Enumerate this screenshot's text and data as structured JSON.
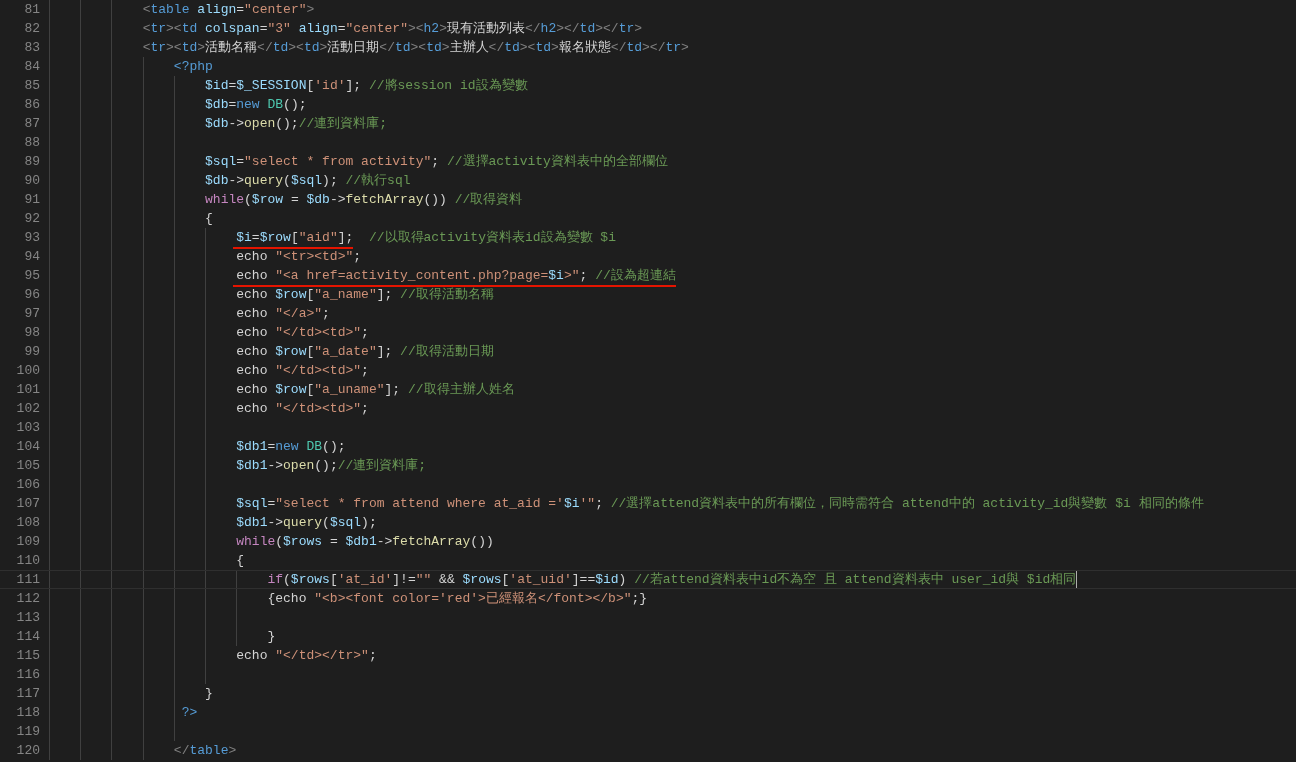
{
  "editor": {
    "lines": [
      {
        "n": "81",
        "current": false,
        "tokens": [
          {
            "text": "            <",
            "kind": "tb"
          },
          {
            "text": "table ",
            "kind": "tg"
          },
          {
            "text": "align",
            "kind": "at"
          },
          {
            "text": "=",
            "kind": "p"
          },
          {
            "text": "\"center\"",
            "kind": "s"
          },
          {
            "text": ">",
            "kind": "tb"
          }
        ]
      },
      {
        "n": "82",
        "current": false,
        "tokens": [
          {
            "text": "            <",
            "kind": "tb"
          },
          {
            "text": "tr",
            "kind": "tg"
          },
          {
            "text": "><",
            "kind": "tb"
          },
          {
            "text": "td ",
            "kind": "tg"
          },
          {
            "text": "colspan",
            "kind": "at"
          },
          {
            "text": "=",
            "kind": "p"
          },
          {
            "text": "\"3\" ",
            "kind": "s"
          },
          {
            "text": "align",
            "kind": "at"
          },
          {
            "text": "=",
            "kind": "p"
          },
          {
            "text": "\"center\"",
            "kind": "s"
          },
          {
            "text": "><",
            "kind": "tb"
          },
          {
            "text": "h2",
            "kind": "tg"
          },
          {
            "text": ">",
            "kind": "tb"
          },
          {
            "text": "現有活動列表",
            "kind": "p"
          },
          {
            "text": "</",
            "kind": "tb"
          },
          {
            "text": "h2",
            "kind": "tg"
          },
          {
            "text": "></",
            "kind": "tb"
          },
          {
            "text": "td",
            "kind": "tg"
          },
          {
            "text": "></",
            "kind": "tb"
          },
          {
            "text": "tr",
            "kind": "tg"
          },
          {
            "text": ">",
            "kind": "tb"
          }
        ]
      },
      {
        "n": "83",
        "current": false,
        "tokens": [
          {
            "text": "            <",
            "kind": "tb"
          },
          {
            "text": "tr",
            "kind": "tg"
          },
          {
            "text": "><",
            "kind": "tb"
          },
          {
            "text": "td",
            "kind": "tg"
          },
          {
            "text": ">",
            "kind": "tb"
          },
          {
            "text": "活動名稱",
            "kind": "p"
          },
          {
            "text": "</",
            "kind": "tb"
          },
          {
            "text": "td",
            "kind": "tg"
          },
          {
            "text": "><",
            "kind": "tb"
          },
          {
            "text": "td",
            "kind": "tg"
          },
          {
            "text": ">",
            "kind": "tb"
          },
          {
            "text": "活動日期",
            "kind": "p"
          },
          {
            "text": "</",
            "kind": "tb"
          },
          {
            "text": "td",
            "kind": "tg"
          },
          {
            "text": "><",
            "kind": "tb"
          },
          {
            "text": "td",
            "kind": "tg"
          },
          {
            "text": ">",
            "kind": "tb"
          },
          {
            "text": "主辦人",
            "kind": "p"
          },
          {
            "text": "</",
            "kind": "tb"
          },
          {
            "text": "td",
            "kind": "tg"
          },
          {
            "text": "><",
            "kind": "tb"
          },
          {
            "text": "td",
            "kind": "tg"
          },
          {
            "text": ">",
            "kind": "tb"
          },
          {
            "text": "報名狀態",
            "kind": "p"
          },
          {
            "text": "</",
            "kind": "tb"
          },
          {
            "text": "td",
            "kind": "tg"
          },
          {
            "text": "></",
            "kind": "tb"
          },
          {
            "text": "tr",
            "kind": "tg"
          },
          {
            "text": ">",
            "kind": "tb"
          }
        ]
      },
      {
        "n": "84",
        "current": false,
        "tokens": [
          {
            "text": "                <?php",
            "kind": "ph"
          }
        ]
      },
      {
        "n": "85",
        "current": false,
        "tokens": [
          {
            "text": "                    $id",
            "kind": "v"
          },
          {
            "text": "=",
            "kind": "p"
          },
          {
            "text": "$_SESSION",
            "kind": "v"
          },
          {
            "text": "[",
            "kind": "p"
          },
          {
            "text": "'id'",
            "kind": "s"
          },
          {
            "text": "]; ",
            "kind": "p"
          },
          {
            "text": "//將session id設為變數",
            "kind": "c"
          }
        ]
      },
      {
        "n": "86",
        "current": false,
        "tokens": [
          {
            "text": "                    $db",
            "kind": "v"
          },
          {
            "text": "=",
            "kind": "p"
          },
          {
            "text": "new ",
            "kind": "st"
          },
          {
            "text": "DB",
            "kind": "cl"
          },
          {
            "text": "();",
            "kind": "p"
          }
        ]
      },
      {
        "n": "87",
        "current": false,
        "tokens": [
          {
            "text": "                    $db",
            "kind": "v"
          },
          {
            "text": "->",
            "kind": "p"
          },
          {
            "text": "open",
            "kind": "f"
          },
          {
            "text": "();",
            "kind": "p"
          },
          {
            "text": "//連到資料庫;",
            "kind": "c"
          }
        ]
      },
      {
        "n": "88",
        "current": false
      },
      {
        "n": "89",
        "current": false,
        "tokens": [
          {
            "text": "                    $sql",
            "kind": "v"
          },
          {
            "text": "=",
            "kind": "p"
          },
          {
            "text": "\"select * from activity\"",
            "kind": "s"
          },
          {
            "text": "; ",
            "kind": "p"
          },
          {
            "text": "//選擇activity資料表中的全部欄位",
            "kind": "c"
          }
        ]
      },
      {
        "n": "90",
        "current": false,
        "tokens": [
          {
            "text": "                    $db",
            "kind": "v"
          },
          {
            "text": "->",
            "kind": "p"
          },
          {
            "text": "query",
            "kind": "f"
          },
          {
            "text": "(",
            "kind": "p"
          },
          {
            "text": "$sql",
            "kind": "v"
          },
          {
            "text": "); ",
            "kind": "p"
          },
          {
            "text": "//執行sql",
            "kind": "c"
          }
        ]
      },
      {
        "n": "91",
        "current": false,
        "tokens": [
          {
            "text": "                    while",
            "kind": "kw"
          },
          {
            "text": "(",
            "kind": "p"
          },
          {
            "text": "$row",
            "kind": "v"
          },
          {
            "text": " = ",
            "kind": "p"
          },
          {
            "text": "$db",
            "kind": "v"
          },
          {
            "text": "->",
            "kind": "p"
          },
          {
            "text": "fetchArray",
            "kind": "f"
          },
          {
            "text": "()) ",
            "kind": "p"
          },
          {
            "text": "//取得資料",
            "kind": "c"
          }
        ]
      },
      {
        "n": "92",
        "current": false,
        "tokens": [
          {
            "text": "                    {",
            "kind": "p"
          }
        ]
      },
      {
        "n": "93",
        "current": false,
        "tokens": [
          {
            "text": "                        $i",
            "kind": "v",
            "underlined": true
          },
          {
            "text": "=",
            "kind": "p",
            "underlined": true
          },
          {
            "text": "$row",
            "kind": "v",
            "underlined": true
          },
          {
            "text": "[",
            "kind": "p",
            "underlined": true
          },
          {
            "text": "\"aid\"",
            "kind": "s",
            "underlined": true
          },
          {
            "text": "];",
            "kind": "p",
            "underlined": true
          },
          {
            "text": "  //以取得activity資料表id設為變數 $i",
            "kind": "c"
          }
        ]
      },
      {
        "n": "94",
        "current": false,
        "tokens": [
          {
            "text": "                        echo ",
            "kind": "p"
          },
          {
            "text": "\"<tr><td>\"",
            "kind": "s"
          },
          {
            "text": ";",
            "kind": "p"
          }
        ]
      },
      {
        "n": "95",
        "current": false,
        "tokens": [
          {
            "text": "                        echo ",
            "kind": "p",
            "underlined": true
          },
          {
            "text": "\"<a href=activity_content.php?page=",
            "kind": "s",
            "underlined": true
          },
          {
            "text": "$i",
            "kind": "v",
            "underlined": true
          },
          {
            "text": ">\"",
            "kind": "s",
            "underlined": true
          },
          {
            "text": "; ",
            "kind": "p",
            "underlined": true
          },
          {
            "text": "//設為超連結",
            "kind": "c",
            "underlined": true
          }
        ]
      },
      {
        "n": "96",
        "current": false,
        "tokens": [
          {
            "text": "                        echo ",
            "kind": "p"
          },
          {
            "text": "$row",
            "kind": "v"
          },
          {
            "text": "[",
            "kind": "p"
          },
          {
            "text": "\"a_name\"",
            "kind": "s"
          },
          {
            "text": "]; ",
            "kind": "p"
          },
          {
            "text": "//取得活動名稱",
            "kind": "c"
          }
        ]
      },
      {
        "n": "97",
        "current": false,
        "tokens": [
          {
            "text": "                        echo ",
            "kind": "p"
          },
          {
            "text": "\"</a>\"",
            "kind": "s"
          },
          {
            "text": ";",
            "kind": "p"
          }
        ]
      },
      {
        "n": "98",
        "current": false,
        "tokens": [
          {
            "text": "                        echo ",
            "kind": "p"
          },
          {
            "text": "\"</td><td>\"",
            "kind": "s"
          },
          {
            "text": ";",
            "kind": "p"
          }
        ]
      },
      {
        "n": "99",
        "current": false,
        "tokens": [
          {
            "text": "                        echo ",
            "kind": "p"
          },
          {
            "text": "$row",
            "kind": "v"
          },
          {
            "text": "[",
            "kind": "p"
          },
          {
            "text": "\"a_date\"",
            "kind": "s"
          },
          {
            "text": "]; ",
            "kind": "p"
          },
          {
            "text": "//取得活動日期",
            "kind": "c"
          }
        ]
      },
      {
        "n": "100",
        "current": false,
        "tokens": [
          {
            "text": "                        echo ",
            "kind": "p"
          },
          {
            "text": "\"</td><td>\"",
            "kind": "s"
          },
          {
            "text": ";",
            "kind": "p"
          }
        ]
      },
      {
        "n": "101",
        "current": false,
        "tokens": [
          {
            "text": "                        echo ",
            "kind": "p"
          },
          {
            "text": "$row",
            "kind": "v"
          },
          {
            "text": "[",
            "kind": "p"
          },
          {
            "text": "\"a_uname\"",
            "kind": "s"
          },
          {
            "text": "]; ",
            "kind": "p"
          },
          {
            "text": "//取得主辦人姓名",
            "kind": "c"
          }
        ]
      },
      {
        "n": "102",
        "current": false,
        "tokens": [
          {
            "text": "                        echo ",
            "kind": "p"
          },
          {
            "text": "\"</td><td>\"",
            "kind": "s"
          },
          {
            "text": ";",
            "kind": "p"
          }
        ]
      },
      {
        "n": "103",
        "current": false
      },
      {
        "n": "104",
        "current": false,
        "tokens": [
          {
            "text": "                        $db1",
            "kind": "v"
          },
          {
            "text": "=",
            "kind": "p"
          },
          {
            "text": "new ",
            "kind": "st"
          },
          {
            "text": "DB",
            "kind": "cl"
          },
          {
            "text": "();",
            "kind": "p"
          }
        ]
      },
      {
        "n": "105",
        "current": false,
        "tokens": [
          {
            "text": "                        $db1",
            "kind": "v"
          },
          {
            "text": "->",
            "kind": "p"
          },
          {
            "text": "open",
            "kind": "f"
          },
          {
            "text": "();",
            "kind": "p"
          },
          {
            "text": "//連到資料庫;",
            "kind": "c"
          }
        ]
      },
      {
        "n": "106",
        "current": false
      },
      {
        "n": "107",
        "current": false,
        "tokens": [
          {
            "text": "                        $sql",
            "kind": "v"
          },
          {
            "text": "=",
            "kind": "p"
          },
          {
            "text": "\"select * from attend where at_aid ='",
            "kind": "s"
          },
          {
            "text": "$i",
            "kind": "v"
          },
          {
            "text": "'\"",
            "kind": "s"
          },
          {
            "text": "; ",
            "kind": "p"
          },
          {
            "text": "//選擇attend資料表中的所有欄位，同時需符合 attend中的 activity_id與變數 $i 相同的條件",
            "kind": "c"
          }
        ]
      },
      {
        "n": "108",
        "current": false,
        "tokens": [
          {
            "text": "                        $db1",
            "kind": "v"
          },
          {
            "text": "->",
            "kind": "p"
          },
          {
            "text": "query",
            "kind": "f"
          },
          {
            "text": "(",
            "kind": "p"
          },
          {
            "text": "$sql",
            "kind": "v"
          },
          {
            "text": ");",
            "kind": "p"
          }
        ]
      },
      {
        "n": "109",
        "current": false,
        "tokens": [
          {
            "text": "                        while",
            "kind": "kw"
          },
          {
            "text": "(",
            "kind": "p"
          },
          {
            "text": "$rows",
            "kind": "v"
          },
          {
            "text": " = ",
            "kind": "p"
          },
          {
            "text": "$db1",
            "kind": "v"
          },
          {
            "text": "->",
            "kind": "p"
          },
          {
            "text": "fetchArray",
            "kind": "f"
          },
          {
            "text": "())",
            "kind": "p"
          }
        ]
      },
      {
        "n": "110",
        "current": false,
        "tokens": [
          {
            "text": "                        {",
            "kind": "p"
          }
        ]
      },
      {
        "n": "111",
        "current": true,
        "tokens": [
          {
            "text": "                            if",
            "kind": "kw"
          },
          {
            "text": "(",
            "kind": "p"
          },
          {
            "text": "$rows",
            "kind": "v"
          },
          {
            "text": "[",
            "kind": "p"
          },
          {
            "text": "'at_id'",
            "kind": "s"
          },
          {
            "text": "]!=",
            "kind": "p"
          },
          {
            "text": "\"\"",
            "kind": "s"
          },
          {
            "text": " && ",
            "kind": "p"
          },
          {
            "text": "$rows",
            "kind": "v"
          },
          {
            "text": "[",
            "kind": "p"
          },
          {
            "text": "'at_uid'",
            "kind": "s"
          },
          {
            "text": "]==",
            "kind": "p"
          },
          {
            "text": "$id",
            "kind": "v"
          },
          {
            "text": ") ",
            "kind": "p"
          },
          {
            "text": "//若attend資料表中id不為空 且 attend資料表中 user_id與 $id相同",
            "kind": "c"
          }
        ]
      },
      {
        "n": "112",
        "current": false,
        "tokens": [
          {
            "text": "                            {echo ",
            "kind": "p"
          },
          {
            "text": "\"<b><font color='red'>已經報名</font></b>\"",
            "kind": "s"
          },
          {
            "text": ";}",
            "kind": "p"
          }
        ]
      },
      {
        "n": "113",
        "current": false
      },
      {
        "n": "114",
        "current": false,
        "tokens": [
          {
            "text": "                            }",
            "kind": "p"
          }
        ]
      },
      {
        "n": "115",
        "current": false,
        "tokens": [
          {
            "text": "                        echo ",
            "kind": "p"
          },
          {
            "text": "\"</td></tr>\"",
            "kind": "s"
          },
          {
            "text": ";",
            "kind": "p"
          }
        ]
      },
      {
        "n": "116",
        "current": false
      },
      {
        "n": "117",
        "current": false,
        "tokens": [
          {
            "text": "                    }",
            "kind": "p"
          }
        ]
      },
      {
        "n": "118",
        "current": false,
        "tokens": [
          {
            "text": "                 ?>",
            "kind": "ph"
          }
        ]
      },
      {
        "n": "119",
        "current": false
      },
      {
        "n": "120",
        "current": false,
        "tokens": [
          {
            "text": "                </",
            "kind": "tb"
          },
          {
            "text": "table",
            "kind": "tg"
          },
          {
            "text": ">",
            "kind": "tb"
          }
        ]
      }
    ]
  }
}
